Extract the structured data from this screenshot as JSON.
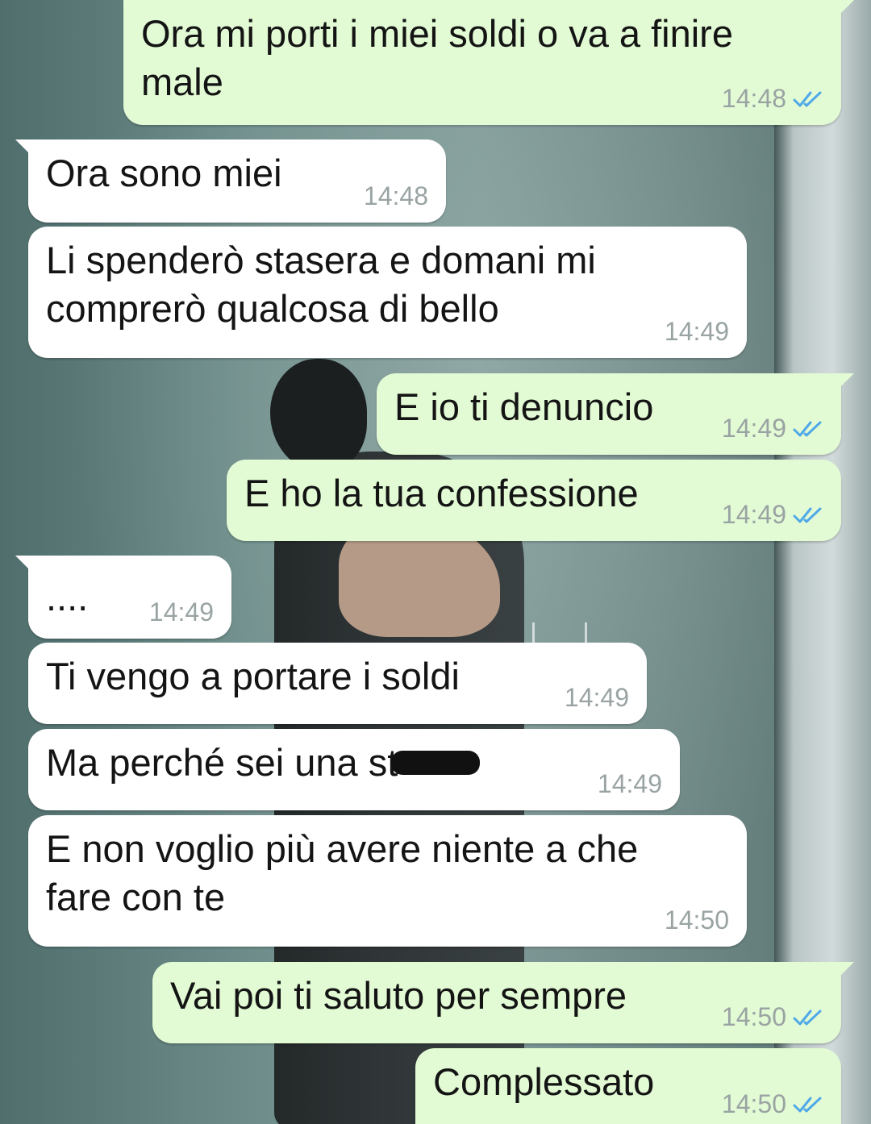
{
  "chat": {
    "messages": [
      {
        "direction": "outgoing",
        "text": "Ora mi porti i miei soldi o va a finire male",
        "time": "14:48",
        "status": "read"
      },
      {
        "direction": "incoming",
        "text": "Ora sono miei",
        "time": "14:48"
      },
      {
        "direction": "incoming",
        "text": "Li spenderò stasera e domani mi comprerò qualcosa di bello",
        "time": "14:49"
      },
      {
        "direction": "outgoing",
        "text": "E io ti denuncio",
        "time": "14:49",
        "status": "read"
      },
      {
        "direction": "outgoing",
        "text": "E ho la tua confessione",
        "time": "14:49",
        "status": "read"
      },
      {
        "direction": "incoming",
        "text": "....",
        "time": "14:49"
      },
      {
        "direction": "incoming",
        "text": "Ti vengo a portare i soldi",
        "time": "14:49"
      },
      {
        "direction": "incoming",
        "text": "Ma perché sei una st",
        "redacted": true,
        "time": "14:49"
      },
      {
        "direction": "incoming",
        "text": "E non voglio più avere niente a che fare con te",
        "time": "14:50"
      },
      {
        "direction": "outgoing",
        "text": "Vai poi ti saluto per sempre",
        "time": "14:50",
        "status": "read"
      },
      {
        "direction": "outgoing",
        "text": "Complessato",
        "time": "14:50",
        "status": "read"
      }
    ]
  },
  "colors": {
    "outgoing_bubble": "#e2fbd4",
    "incoming_bubble": "#ffffff",
    "read_ticks": "#4fa8e8",
    "timestamp": "#9aa3a3"
  },
  "icons": {
    "read_receipt": "double-check-icon"
  }
}
